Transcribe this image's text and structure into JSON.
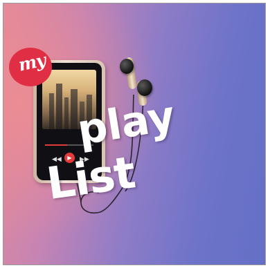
{
  "badge": {
    "text": "my",
    "color": "#e02f45"
  },
  "title": {
    "line1": "play",
    "line2": "List"
  },
  "player": {
    "progress": 0.45,
    "accent": "#e53a3a"
  },
  "colors": {
    "background_left": "#e48a98",
    "background_right": "#6470c6"
  },
  "icons": {
    "player": "music-player-icon",
    "earphones": "earphones-icon",
    "play": "play-icon"
  }
}
